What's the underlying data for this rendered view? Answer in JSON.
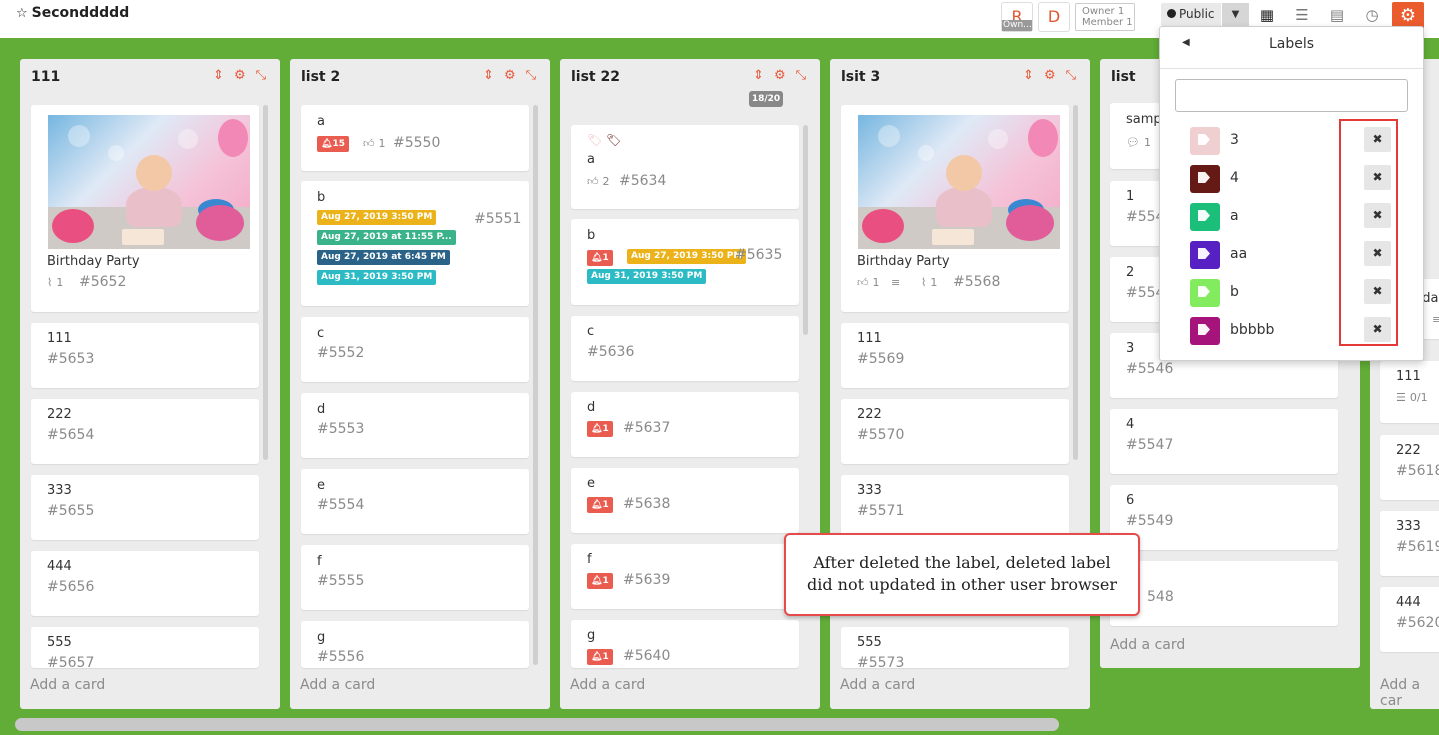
{
  "header": {
    "board_title": "Seconddddd",
    "avatar_r": "R",
    "avatar_r_badge": "Own...",
    "avatar_d": "D",
    "role_owner": "Owner 1",
    "role_member": "Member 1",
    "visibility": "Public",
    "accent_color": "#ea5b2d"
  },
  "lists": [
    {
      "title": "111",
      "add_card": "Add a card",
      "cards": [
        {
          "title": "Birthday Party",
          "attachments": "1",
          "id": "#5652"
        },
        {
          "title": "111",
          "id": "#5653"
        },
        {
          "title": "222",
          "id": "#5654"
        },
        {
          "title": "333",
          "id": "#5655"
        },
        {
          "title": "444",
          "id": "#5656"
        },
        {
          "title": "555",
          "id": "#5657"
        }
      ]
    },
    {
      "title": "list 2",
      "add_card": "Add a card",
      "cards": [
        {
          "title": "a",
          "alarm": "15",
          "votes": "1",
          "id": "#5550"
        },
        {
          "title": "b",
          "id": "#5551",
          "dues": [
            "Aug 27, 2019 3:50 PM",
            "Aug 27, 2019 at 11:55 P...",
            "Aug 27, 2019 at 6:45 PM",
            "Aug 31, 2019 3:50 PM"
          ]
        },
        {
          "title": "c",
          "id": "#5552"
        },
        {
          "title": "d",
          "id": "#5553"
        },
        {
          "title": "e",
          "id": "#5554"
        },
        {
          "title": "f",
          "id": "#5555"
        },
        {
          "title": "g",
          "id": "#5556"
        }
      ]
    },
    {
      "title": "list 22",
      "badge": "18/20",
      "add_card": "Add a card",
      "cards": [
        {
          "title": "a",
          "votes": "2",
          "id": "#5634"
        },
        {
          "title": "b",
          "alarm": "1",
          "id": "#5635",
          "dues": [
            "Aug 27, 2019 3:50 PM",
            "Aug 31, 2019 3:50 PM"
          ]
        },
        {
          "title": "c",
          "id": "#5636"
        },
        {
          "title": "d",
          "alarm": "1",
          "id": "#5637"
        },
        {
          "title": "e",
          "alarm": "1",
          "id": "#5638"
        },
        {
          "title": "f",
          "alarm": "1",
          "id": "#5639"
        },
        {
          "title": "g",
          "alarm": "1",
          "id": "#5640"
        }
      ]
    },
    {
      "title": "lsit 3",
      "add_card": "Add a card",
      "cards": [
        {
          "title": "Birthday Party",
          "votes": "1",
          "attachments": "1",
          "id": "#5568"
        },
        {
          "title": "111",
          "id": "#5569"
        },
        {
          "title": "222",
          "id": "#5570"
        },
        {
          "title": "333",
          "id": "#5571"
        },
        {
          "title": "555",
          "id": "#5573"
        }
      ]
    },
    {
      "title": "list",
      "add_card": "Add a card",
      "cards": [
        {
          "title": "samp",
          "comments": "1"
        },
        {
          "title": "1",
          "id": "#554"
        },
        {
          "title": "2",
          "id": "#554"
        },
        {
          "title": "3",
          "id": "#5546"
        },
        {
          "title": "4",
          "id": "#5547"
        },
        {
          "title": "6",
          "id": "#5549"
        },
        {
          "title": "",
          "id": "548"
        }
      ]
    },
    {
      "title": "",
      "add_card": "Add a car",
      "cards": [
        {
          "title": "nda"
        },
        {
          "title": "111",
          "checklist": "0/1"
        },
        {
          "title": "222",
          "id": "#5618"
        },
        {
          "title": "333",
          "id": "#5619"
        },
        {
          "title": "444",
          "id": "#5620"
        }
      ]
    }
  ],
  "labels_popup": {
    "title": "Labels",
    "search_value": "",
    "labels": [
      {
        "name": "3",
        "color": "#efcfcf"
      },
      {
        "name": "4",
        "color": "#661a16"
      },
      {
        "name": "a",
        "color": "#1bbf7a"
      },
      {
        "name": "aa",
        "color": "#5620c2"
      },
      {
        "name": "b",
        "color": "#82ec5e"
      },
      {
        "name": "bbbbb",
        "color": "#a6137a"
      }
    ],
    "delete_glyph": "✖"
  },
  "callout": {
    "line1": "After deleted the label, deleted label",
    "line2": "did not updated in other user browser"
  }
}
